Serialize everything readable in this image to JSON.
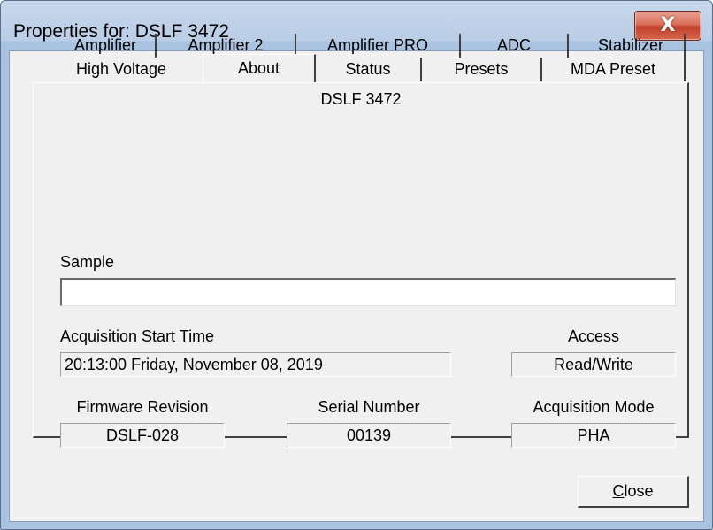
{
  "window": {
    "title": "Properties for: DSLF 3472",
    "close_glyph": "X"
  },
  "tabs": {
    "row1": [
      "Amplifier",
      "Amplifier 2",
      "Amplifier PRO",
      "ADC",
      "Stabilizer"
    ],
    "row2": [
      "High Voltage",
      "About",
      "Status",
      "Presets",
      "MDA Preset"
    ],
    "active": "About"
  },
  "about": {
    "device_name": "DSLF 3472",
    "sample_label": "Sample",
    "sample_value": "",
    "acq_start_label": "Acquisition Start Time",
    "acq_start_value": "20:13:00 Friday, November 08, 2019",
    "access_label": "Access",
    "access_value": "Read/Write",
    "firmware_label": "Firmware Revision",
    "firmware_value": "DSLF-028",
    "serial_label": "Serial Number",
    "serial_value": "00139",
    "acq_mode_label": "Acquisition Mode",
    "acq_mode_value": "PHA"
  },
  "footer": {
    "close_label_prefix": "",
    "close_label_underline": "C",
    "close_label_rest": "lose"
  },
  "icons": {
    "close": "close-icon"
  }
}
